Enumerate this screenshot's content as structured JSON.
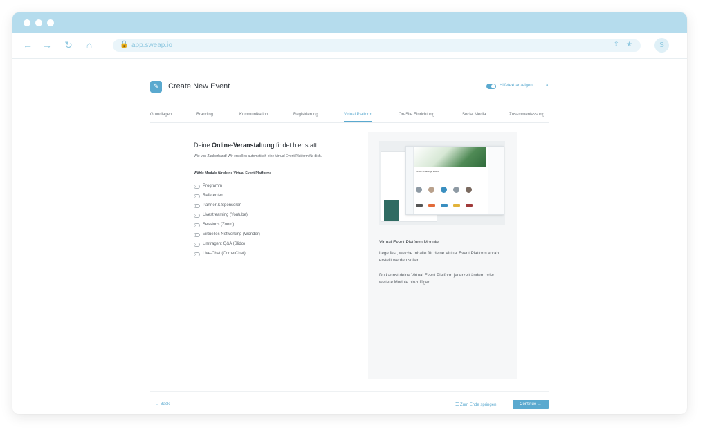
{
  "browser": {
    "url": "app.sweap.io",
    "avatar_initial": "S",
    "icons": {
      "back": "←",
      "forward": "→",
      "reload": "↻",
      "home": "⌂",
      "lock": "🔒",
      "share": "⇪",
      "bookmark": "★"
    }
  },
  "header": {
    "title": "Create New Event",
    "icon": "✎",
    "help_text": "Hilfetext anzeigen",
    "close": "×"
  },
  "tabs": [
    {
      "label": "Grundlagen"
    },
    {
      "label": "Branding"
    },
    {
      "label": "Kommunikation"
    },
    {
      "label": "Registrierung"
    },
    {
      "label": "Virtual Platform"
    },
    {
      "label": "On-Site Einrichtung"
    },
    {
      "label": "Social Media"
    },
    {
      "label": "Zusammenfassung"
    }
  ],
  "active_tab": "Virtual Platform",
  "section": {
    "title_pre": "Deine ",
    "title_bold": "Online-Veranstaltung",
    "title_post": " findet hier statt",
    "subtitle": "Wie von Zauberhand! Wir erstellen automatisch eine Virtual Event Platform für dich.",
    "modules_label": "Wähle Module für deine Virtual Event Platform:",
    "modules": [
      {
        "label": "Programm"
      },
      {
        "label": "Referenten"
      },
      {
        "label": "Partner & Sponsoren"
      },
      {
        "label": "Livestreaming (Youtube)"
      },
      {
        "label": "Sessions (Zoom)"
      },
      {
        "label": "Virtuelles Networking (Wonder)"
      },
      {
        "label": "Umfragen: Q&A (Slido)"
      },
      {
        "label": "Live-Chat (CometChat)"
      }
    ]
  },
  "info": {
    "preview_title": "Virtual Schallenge Events",
    "title": "Virtual Event Platform Module",
    "p1": "Lege fest, welche Inhalte für deine Virtual Event Platform vorab erstellt werden sollen.",
    "p2": "Du kannst deine Virtual Event Platform jederzeit ändern oder weitere Module hinzufügen."
  },
  "footer": {
    "back": "← Back",
    "skip": "☷ Zum Ende springen",
    "continue": "Continue →"
  },
  "colors": {
    "accent": "#5aa9cf",
    "titlebar": "#b5dced"
  }
}
